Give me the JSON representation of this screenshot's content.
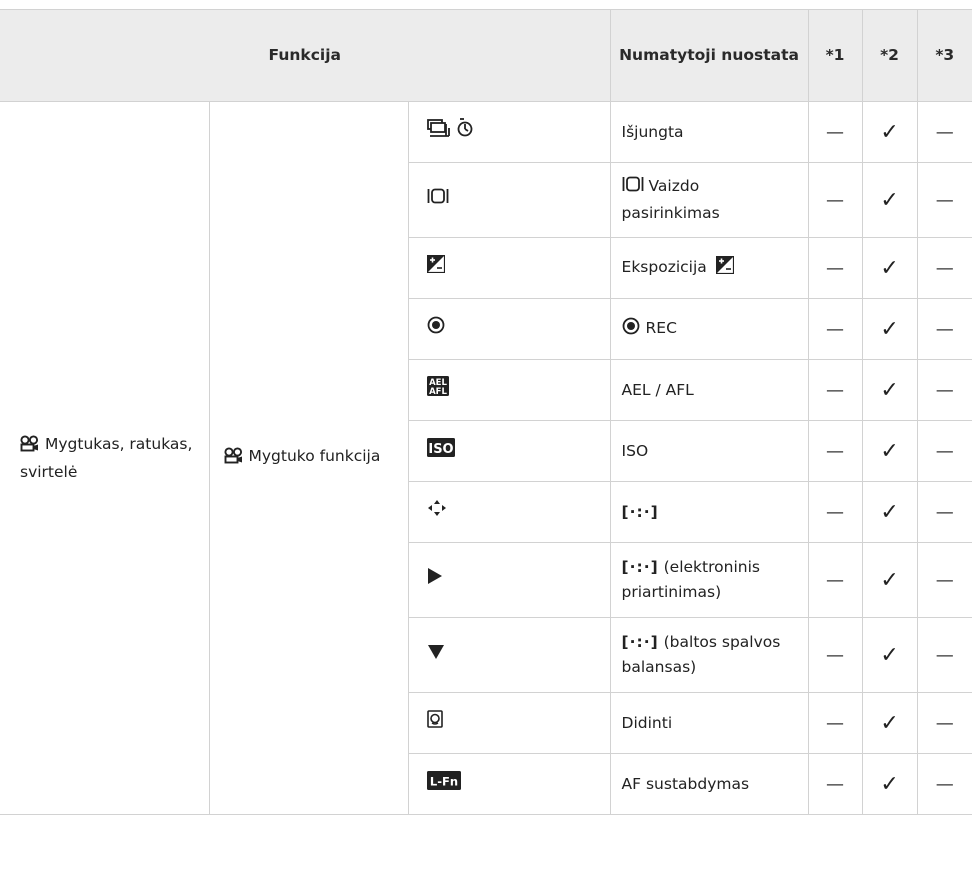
{
  "header": {
    "function": "Funkcija",
    "default": "Numatytoji nuostata",
    "c1": "*1",
    "c2": "*2",
    "c3": "*3"
  },
  "group": {
    "level1": "Mygtukas, ratukas, svirtelė",
    "level2": "Mygtuko funkcija"
  },
  "marks": {
    "dash": "—",
    "check": "✓"
  },
  "rows": [
    {
      "icon": "drive-selftimer-icon",
      "default": "Išjungta",
      "c1": "—",
      "c2": "✓",
      "c3": "—"
    },
    {
      "icon": "frame-select-icon",
      "default": "Vaizdo pasirinkimas",
      "c1": "—",
      "c2": "✓",
      "c3": "—"
    },
    {
      "icon": "exposure-comp-icon",
      "default": "Ekspozicija",
      "c1": "—",
      "c2": "✓",
      "c3": "—"
    },
    {
      "icon": "rec-icon",
      "default": "REC",
      "c1": "—",
      "c2": "✓",
      "c3": "—"
    },
    {
      "icon": "ael-afl-icon",
      "default": "AEL / AFL",
      "c1": "—",
      "c2": "✓",
      "c3": "—"
    },
    {
      "icon": "iso-icon",
      "default": "ISO",
      "c1": "—",
      "c2": "✓",
      "c3": "—"
    },
    {
      "icon": "arrow-pad-icon",
      "default": "[·:·]",
      "c1": "—",
      "c2": "✓",
      "c3": "—"
    },
    {
      "icon": "play-right-icon",
      "default_grid": "[·:·]",
      "default": "(elektroninis priartinimas)",
      "c1": "—",
      "c2": "✓",
      "c3": "—"
    },
    {
      "icon": "triangle-down-icon",
      "default_grid": "[·:·]",
      "default": "(baltos spalvos balansas)",
      "c1": "—",
      "c2": "✓",
      "c3": "—"
    },
    {
      "icon": "magnify-icon",
      "default": "Didinti",
      "c1": "—",
      "c2": "✓",
      "c3": "—"
    },
    {
      "icon": "l-fn-icon",
      "icon_text": "L-Fn",
      "default": "AF sustabdymas",
      "c1": "—",
      "c2": "✓",
      "c3": "—"
    }
  ],
  "icon_texts": {
    "ael_top": "AEL",
    "ael_bottom": "AFL",
    "iso": "ISO"
  }
}
